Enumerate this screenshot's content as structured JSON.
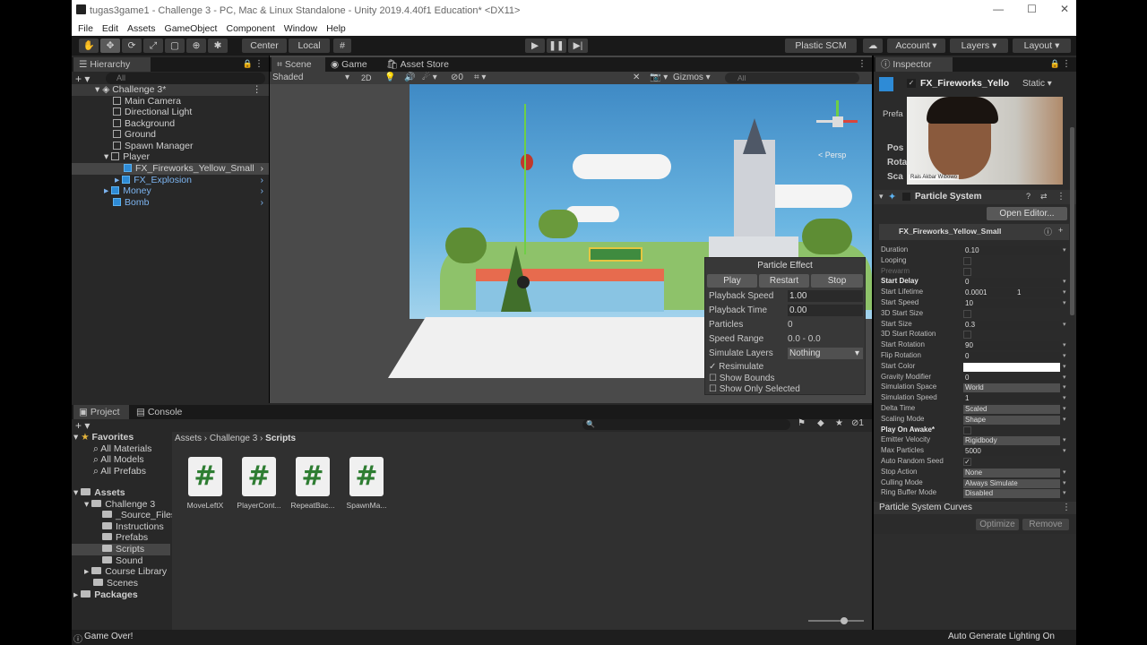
{
  "window": {
    "title": "tugas3game1 - Challenge 3 - PC, Mac & Linux Standalone - Unity 2019.4.40f1 Education* <DX11>",
    "min": "—",
    "max": "☐",
    "close": "✕"
  },
  "menu": [
    "File",
    "Edit",
    "Assets",
    "GameObject",
    "Component",
    "Window",
    "Help"
  ],
  "toolbar": {
    "pivot": "Center",
    "space": "Local",
    "plastic": "Plastic SCM",
    "account": "Account",
    "layers": "Layers",
    "layout": "Layout"
  },
  "hierarchy": {
    "tab": "Hierarchy",
    "search_placeholder": "All",
    "scene": "Challenge 3*",
    "items": [
      {
        "label": "Main Camera"
      },
      {
        "label": "Directional Light"
      },
      {
        "label": "Background"
      },
      {
        "label": "Ground"
      },
      {
        "label": "Spawn Manager"
      },
      {
        "label": "Player"
      },
      {
        "label": "FX_Fireworks_Yellow_Small"
      },
      {
        "label": "FX_Explosion"
      },
      {
        "label": "Money"
      },
      {
        "label": "Bomb"
      }
    ]
  },
  "scene": {
    "tabs": [
      "Scene",
      "Game",
      "Asset Store"
    ],
    "shading": "Shaded",
    "mode2d": "2D",
    "fx_count": "0",
    "gizmos": "Gizmos",
    "search_placeholder": "All",
    "persp": "< Persp"
  },
  "particle_effect": {
    "title": "Particle Effect",
    "play": "Play",
    "restart": "Restart",
    "stop": "Stop",
    "rows": [
      {
        "label": "Playback Speed",
        "value": "1.00"
      },
      {
        "label": "Playback Time",
        "value": "0.00"
      },
      {
        "label": "Particles",
        "value": "0"
      },
      {
        "label": "Speed Range",
        "value": "0.0 - 0.0"
      },
      {
        "label": "Simulate Layers",
        "value": "Nothing"
      }
    ],
    "resimulate": "Resimulate",
    "show_bounds": "Show Bounds",
    "show_only_selected": "Show Only Selected"
  },
  "project": {
    "tabs": [
      "Project",
      "Console"
    ],
    "favorites_label": "Favorites",
    "favorites": [
      "All Materials",
      "All Models",
      "All Prefabs"
    ],
    "assets_label": "Assets",
    "tree": [
      "Challenge 3",
      "_Source_Files",
      "Instructions",
      "Prefabs",
      "Scripts",
      "Sound",
      "Course Library",
      "Scenes"
    ],
    "packages_label": "Packages",
    "breadcrumb": [
      "Assets",
      "Challenge 3",
      "Scripts"
    ],
    "scripts": [
      "MoveLeftX",
      "PlayerCont...",
      "RepeatBac...",
      "SpawnMa..."
    ],
    "script_glyph": "#",
    "hidden_count": "1"
  },
  "inspector": {
    "tab": "Inspector",
    "object_name": "FX_Fireworks_Yello",
    "static_label": "Static",
    "prefab_label": "Prefa",
    "transform_rows": [
      "Pos",
      "Rota",
      "Sca"
    ],
    "component": "Particle System",
    "open_editor": "Open Editor...",
    "system_name": "FX_Fireworks_Yellow_Small",
    "props": [
      {
        "label": "Duration",
        "value": "0.10",
        "type": "val"
      },
      {
        "label": "Looping",
        "value": "",
        "type": "chk"
      },
      {
        "label": "Prewarm",
        "value": "",
        "type": "chk",
        "dim": true
      },
      {
        "label": "Start Delay",
        "value": "0",
        "type": "val",
        "bold": true
      },
      {
        "label": "Start Lifetime",
        "value": "0.0001",
        "value2": "1",
        "type": "val"
      },
      {
        "label": "Start Speed",
        "value": "10",
        "type": "val"
      },
      {
        "label": "3D Start Size",
        "value": "",
        "type": "chk"
      },
      {
        "label": "Start Size",
        "value": "0.3",
        "type": "val"
      },
      {
        "label": "3D Start Rotation",
        "value": "",
        "type": "chk"
      },
      {
        "label": "Start Rotation",
        "value": "90",
        "type": "val"
      },
      {
        "label": "Flip Rotation",
        "value": "0",
        "type": "val"
      },
      {
        "label": "Start Color",
        "value": "",
        "type": "color"
      },
      {
        "label": "Gravity Modifier",
        "value": "0",
        "type": "val"
      },
      {
        "label": "Simulation Space",
        "value": "World",
        "type": "dd"
      },
      {
        "label": "Simulation Speed",
        "value": "1",
        "type": "val"
      },
      {
        "label": "Delta Time",
        "value": "Scaled",
        "type": "dd"
      },
      {
        "label": "Scaling Mode",
        "value": "Shape",
        "type": "dd"
      },
      {
        "label": "Play On Awake*",
        "value": "",
        "type": "chk",
        "bold": true
      },
      {
        "label": "Emitter Velocity",
        "value": "Rigidbody",
        "type": "dd"
      },
      {
        "label": "Max Particles",
        "value": "5000",
        "type": "val"
      },
      {
        "label": "Auto Random Seed",
        "value": "✓",
        "type": "chk"
      },
      {
        "label": "Stop Action",
        "value": "None",
        "type": "dd"
      },
      {
        "label": "Culling Mode",
        "value": "Always Simulate",
        "type": "dd"
      },
      {
        "label": "Ring Buffer Mode",
        "value": "Disabled",
        "type": "dd"
      }
    ],
    "curves": "Particle System Curves",
    "optimize": "Optimize",
    "remove": "Remove"
  },
  "webcam": {
    "name": "Rais Akbar Wibowo"
  },
  "status": {
    "left": "Game Over!",
    "right": "Auto Generate Lighting On"
  },
  "colors": {
    "accent": "#2e8bd6",
    "sky": "#5fb0e0",
    "panel": "#282828"
  }
}
